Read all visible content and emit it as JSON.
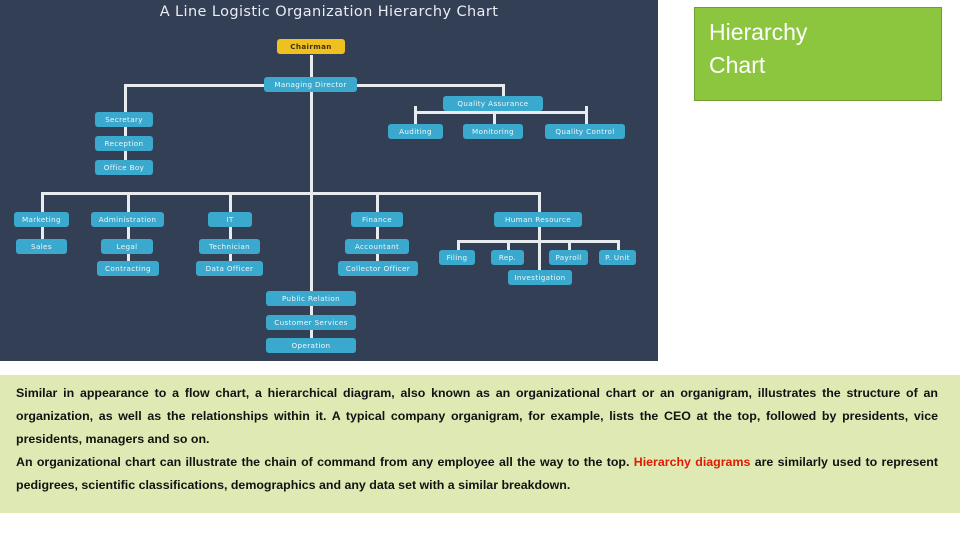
{
  "chart": {
    "title": "A Line Logistic  Organization Hierarchy Chart",
    "background_color": "#323f54",
    "node_color": "#3ba9cd",
    "root_color": "#efc01f",
    "line_color": "#e8ecef",
    "nodes": {
      "chairman": "Chairman",
      "managing_director": "Managing Director",
      "secretary": "Secretary",
      "reception": "Reception",
      "office_boy": "Office Boy",
      "quality_assurance": "Quality Assurance",
      "auditing": "Auditing",
      "monitoring": "Monitoring",
      "quality_control": "Quality Control",
      "marketing": "Marketing",
      "sales": "Sales",
      "administration": "Administration",
      "legal": "Legal",
      "contracting": "Contracting",
      "it": "IT",
      "technician": "Technician",
      "data_officer": "Data Officer",
      "finance": "Finance",
      "accountant": "Accountant",
      "collector_officer": "Collector Officer",
      "human_resource": "Human Resource",
      "filing": "Filing",
      "rep": "Rep.",
      "investigation": "Investigation",
      "payroll": "Payroll",
      "p_unit": "P. Unit",
      "public_relation": "Public Relation",
      "customer_services": "Customer Services",
      "operation": "Operation"
    }
  },
  "heading": {
    "line1": "Hierarchy",
    "line2": "Chart",
    "background_color": "#8cc63e",
    "text_color": "#ffffff"
  },
  "description": {
    "background_color": "#dfe9b4",
    "highlight_color": "#e01b00",
    "paragraph1": "Similar in appearance to a flow chart, a hierarchical diagram, also known as an organizational chart or an organigram, illustrates the structure of an organization, as well as the relationships within it. A typical company organigram, for example, lists the CEO at the top, followed by presidents, vice presidents, managers and so on.",
    "paragraph2_part1": "An organizational chart can illustrate the chain of command from any employee all the way to the top. ",
    "paragraph2_highlight": "Hierarchy diagrams",
    "paragraph2_part2": " are similarly used to represent pedigrees, scientific classifications, demographics and any data set with a similar breakdown."
  }
}
